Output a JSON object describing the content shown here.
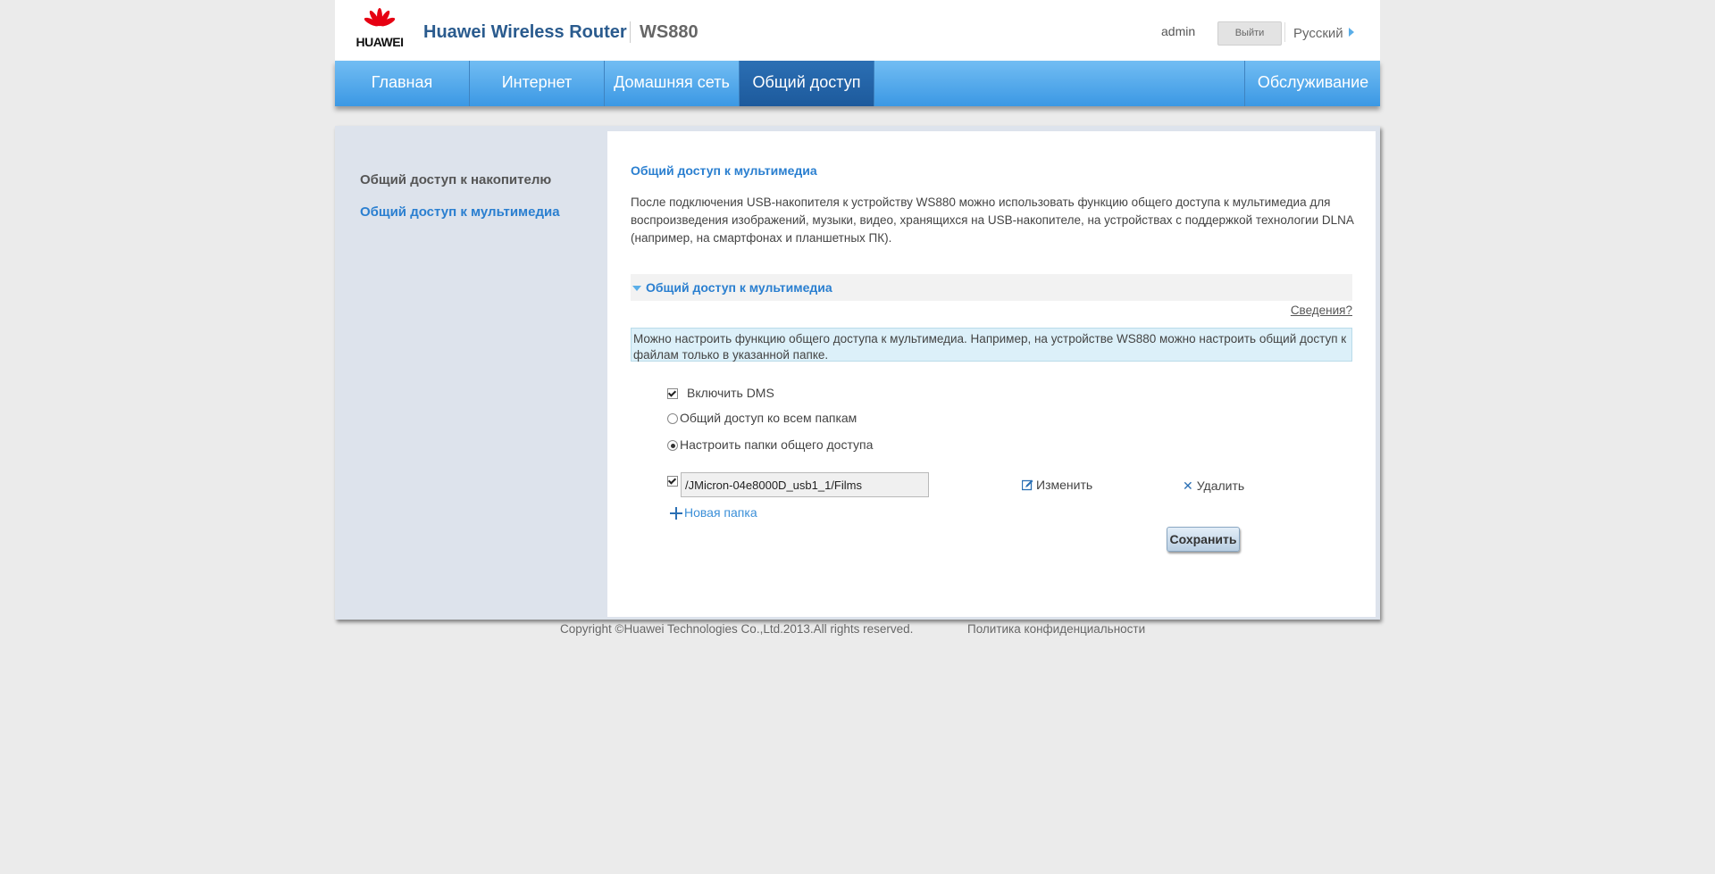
{
  "header": {
    "logo_text": "HUAWEI",
    "brand": "Huawei Wireless Router",
    "model": "WS880",
    "user": "admin",
    "logout_label": "Выйти",
    "language": "Русский"
  },
  "nav": {
    "items": [
      "Главная",
      "Интернет",
      "Домашняя сеть",
      "Общий доступ"
    ],
    "active": "Общий доступ",
    "right_item": "Обслуживание"
  },
  "sidebar": {
    "items": [
      "Общий доступ к накопителю",
      "Общий доступ к мультимедиа"
    ],
    "active_index": 1
  },
  "main": {
    "title": "Общий доступ к мультимедиа",
    "description": "После подключения USB-накопителя к устройству WS880 можно использовать функцию общего доступа к мультимедиа для воспроизведения изображений, музыки, видео, хранящихся на USB-накопителе, на устройствах с поддержкой технологии DLNA (например, на смартфонах и планшетных ПК).",
    "section_title": "Общий доступ к мультимедиа",
    "help_link": "Сведения?",
    "info": "Можно настроить функцию общего доступа к мультимедиа. Например, на устройстве WS880 можно настроить общий доступ к файлам только в указанной папке.",
    "enable_dms_label": "Включить DMS",
    "enable_dms_checked": true,
    "radio_all_label": "Общий доступ ко всем папкам",
    "radio_custom_label": "Настроить папки общего доступа",
    "selected_mode": "custom",
    "folder_path": "/JMicron-04e8000D_usb1_1/Films",
    "folder_checked": true,
    "edit_label": "Изменить",
    "delete_label": "Удалить",
    "new_folder_label": "Новая папка",
    "save_label": "Сохранить"
  },
  "footer": {
    "copyright": "Copyright ©Huawei Technologies Co.,Ltd.2013.All rights reserved.",
    "privacy": "Политика конфиденциальности"
  },
  "colors": {
    "nav_top": "#72bdf3",
    "nav_bottom": "#3b98e4",
    "nav_active": "#1d5a9c",
    "accent": "#2a7fd0",
    "brand": "#2a5b8e",
    "logo_red": "#e60012"
  }
}
